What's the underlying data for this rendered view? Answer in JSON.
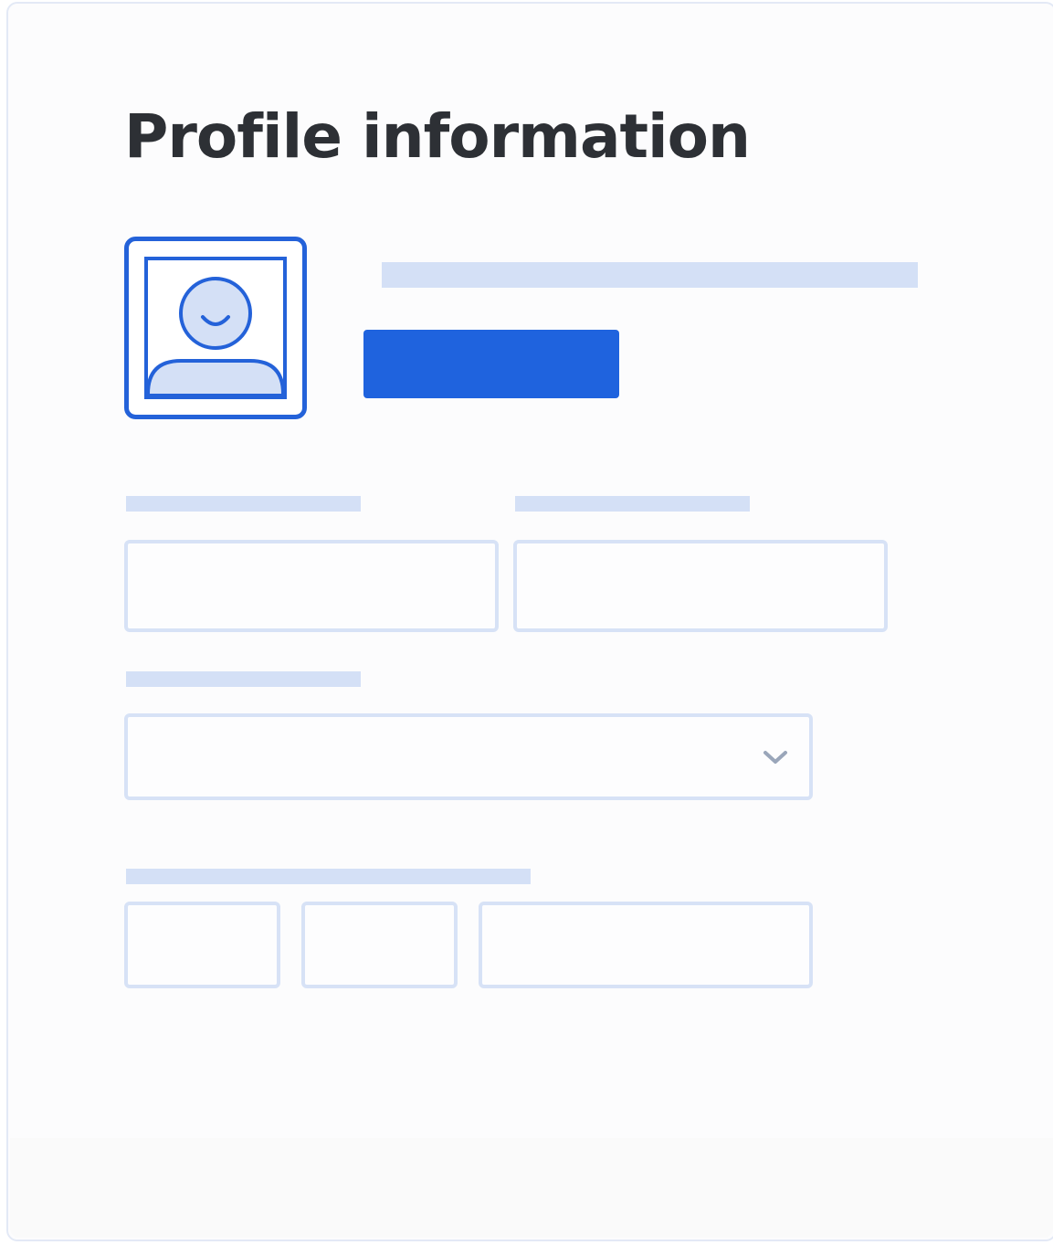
{
  "header": {
    "title": "Profile information"
  },
  "avatar": {
    "icon": "user-avatar-icon"
  },
  "upload_button": {
    "label": ""
  },
  "form": {
    "first_field": {
      "value": "",
      "placeholder": ""
    },
    "second_field": {
      "value": "",
      "placeholder": ""
    },
    "select_field": {
      "selected": "",
      "icon": "chevron-down-icon"
    },
    "segment_fields": [
      {
        "value": "",
        "placeholder": ""
      },
      {
        "value": "",
        "placeholder": ""
      },
      {
        "value": "",
        "placeholder": ""
      }
    ]
  },
  "colors": {
    "accent": "#1f63de",
    "skeleton": "#d4e0f6",
    "field_border": "#d7e2f6",
    "title_text": "#2d3035",
    "chevron": "#9aa6ba"
  }
}
